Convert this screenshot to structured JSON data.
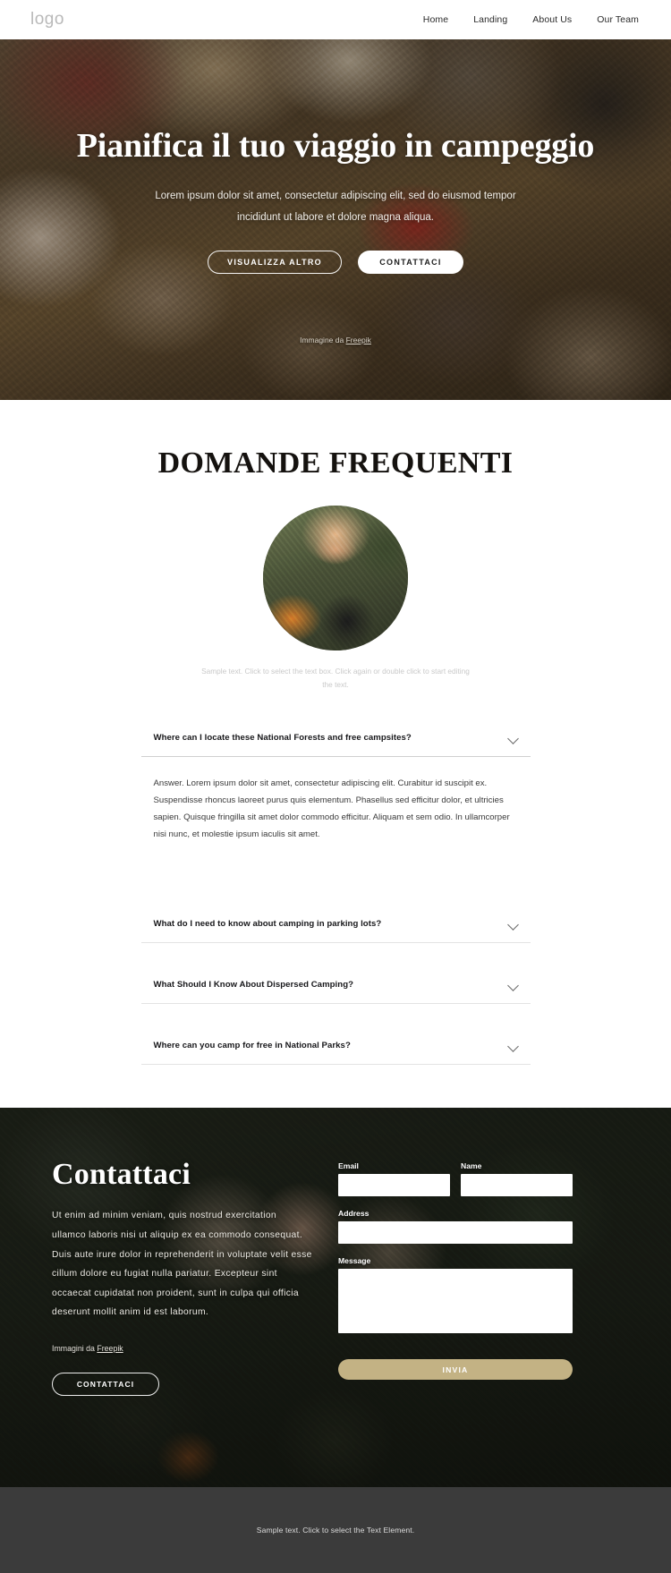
{
  "header": {
    "logo": "logo",
    "nav": [
      {
        "label": "Home"
      },
      {
        "label": "Landing"
      },
      {
        "label": "About Us"
      },
      {
        "label": "Our Team"
      }
    ]
  },
  "hero": {
    "title": "Pianifica il tuo viaggio in campeggio",
    "subtitle": "Lorem ipsum dolor sit amet, consectetur adipiscing elit, sed do eiusmod tempor incididunt ut labore et dolore magna aliqua.",
    "primary_button": "VISUALIZZA ALTRO",
    "secondary_button": "CONTATTACI",
    "credit_prefix": "Immagine da ",
    "credit_link": "Freepik"
  },
  "faq": {
    "title": "DOMANDE FREQUENTI",
    "sample_note": "Sample text. Click to select the text box. Click again or double click to start editing the text.",
    "items": [
      {
        "question": "Where can I locate these National Forests and free campsites?",
        "answer": "Answer. Lorem ipsum dolor sit amet, consectetur adipiscing elit. Curabitur id suscipit ex. Suspendisse rhoncus laoreet purus quis elementum. Phasellus sed efficitur dolor, et ultricies sapien. Quisque fringilla sit amet dolor commodo efficitur. Aliquam et sem odio. In ullamcorper nisi nunc, et molestie ipsum iaculis sit amet.",
        "open": true
      },
      {
        "question": "What do I need to know about camping in parking lots?",
        "answer": "",
        "open": false
      },
      {
        "question": "What Should I Know About Dispersed Camping?",
        "answer": "",
        "open": false
      },
      {
        "question": "Where can you camp for free in National Parks?",
        "answer": "",
        "open": false
      }
    ]
  },
  "contact": {
    "title": "Contattaci",
    "body": "Ut enim ad minim veniam, quis nostrud exercitation ullamco laboris nisi ut aliquip ex ea commodo consequat. Duis aute irure dolor in reprehenderit in voluptate velit esse cillum dolore eu fugiat nulla pariatur. Excepteur sint occaecat cupidatat non proident, sunt in culpa qui officia deserunt mollit anim id est laborum.",
    "credit_prefix": "Immagini da ",
    "credit_link": "Freepik",
    "button": "CONTATTACI",
    "form": {
      "email_label": "Email",
      "email_value": "",
      "name_label": "Name",
      "name_value": "",
      "address_label": "Address",
      "address_value": "",
      "message_label": "Message",
      "message_value": "",
      "submit_label": "INVIA",
      "submit_color": "#c3b284"
    }
  },
  "footer": {
    "text": "Sample text. Click to select the Text Element."
  }
}
